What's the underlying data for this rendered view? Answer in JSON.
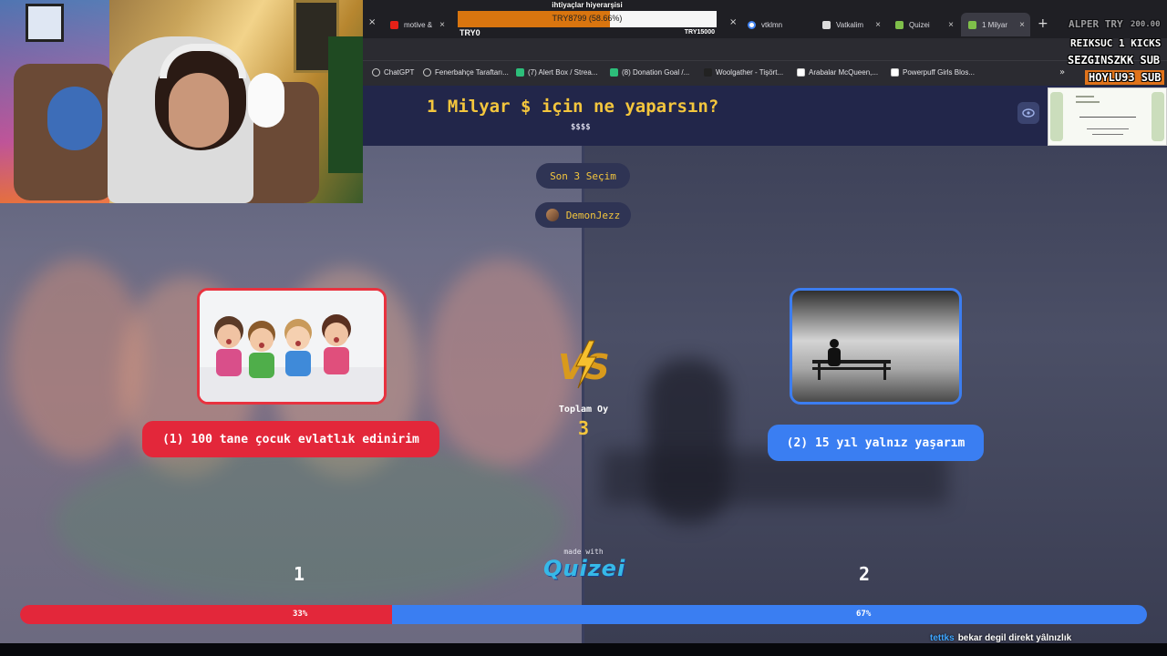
{
  "browser": {
    "left_tabs_close": "×",
    "tabs": [
      {
        "label": "motive &",
        "favicon_color": "#e62117"
      },
      {
        "label": "",
        "favicon_color": "#888888"
      },
      {
        "label": "",
        "favicon_color": "#888888"
      },
      {
        "label": "vtklmn",
        "favicon_color": "#4285f4"
      },
      {
        "label": "Vatkalim",
        "favicon_color": "#dddddd"
      },
      {
        "label": "Quizei",
        "favicon_color": "#7fbf4a"
      },
      {
        "label": "1 Milyar",
        "favicon_color": "#7fbf4a"
      }
    ],
    "new_tab": "+",
    "bookmarks": [
      "ChatGPT",
      "Fenerbahçe Taraftarı...",
      "(7) Alert Box / Strea...",
      "(8) Donation Goal /...",
      "Woolgather - Tişört...",
      "Arabalar McQueen,...",
      "Powerpuff Girls Blos..."
    ],
    "bookmarks_more": "»"
  },
  "donation_goal": {
    "title": "ihtiyaçlar hiyerarşisi",
    "progress_text": "TRY8799 (58.66%)",
    "progress_fraction": 0.5866,
    "min_label": "TRY0",
    "max_label": "TRY15000",
    "bar_color": "#d9750f"
  },
  "overlay": {
    "top_name": "ALPER TRY",
    "top_amount": "200.00",
    "kick_line": "REIKSUC 1 KICKS",
    "sub_line_1": "SEZGINSZKK SUB",
    "sub_line_2": "HOYLU93 SUB"
  },
  "quiz": {
    "title": "1 Milyar $ için ne yaparsın?",
    "subtitle": "$$$$",
    "last_choices_label": "Son 3 Seçim",
    "last_user": "DemonJezz",
    "option_left": {
      "label": "(1) 100 tane çocuk evlatlık edinirim",
      "number": "1",
      "percent_label": "33%",
      "percent": 33,
      "color": "#e3273a"
    },
    "option_right": {
      "label": "(2) 15 yıl yalnız yaşarım",
      "number": "2",
      "percent_label": "67%",
      "percent": 67,
      "color": "#3a7ef2"
    },
    "total_label": "Toplam Oy",
    "total_value": "3",
    "made_with": "made with",
    "brand": "Quizei"
  },
  "chat": {
    "user": "tettks",
    "message": "bekar degil direkt yâlnızlık"
  }
}
